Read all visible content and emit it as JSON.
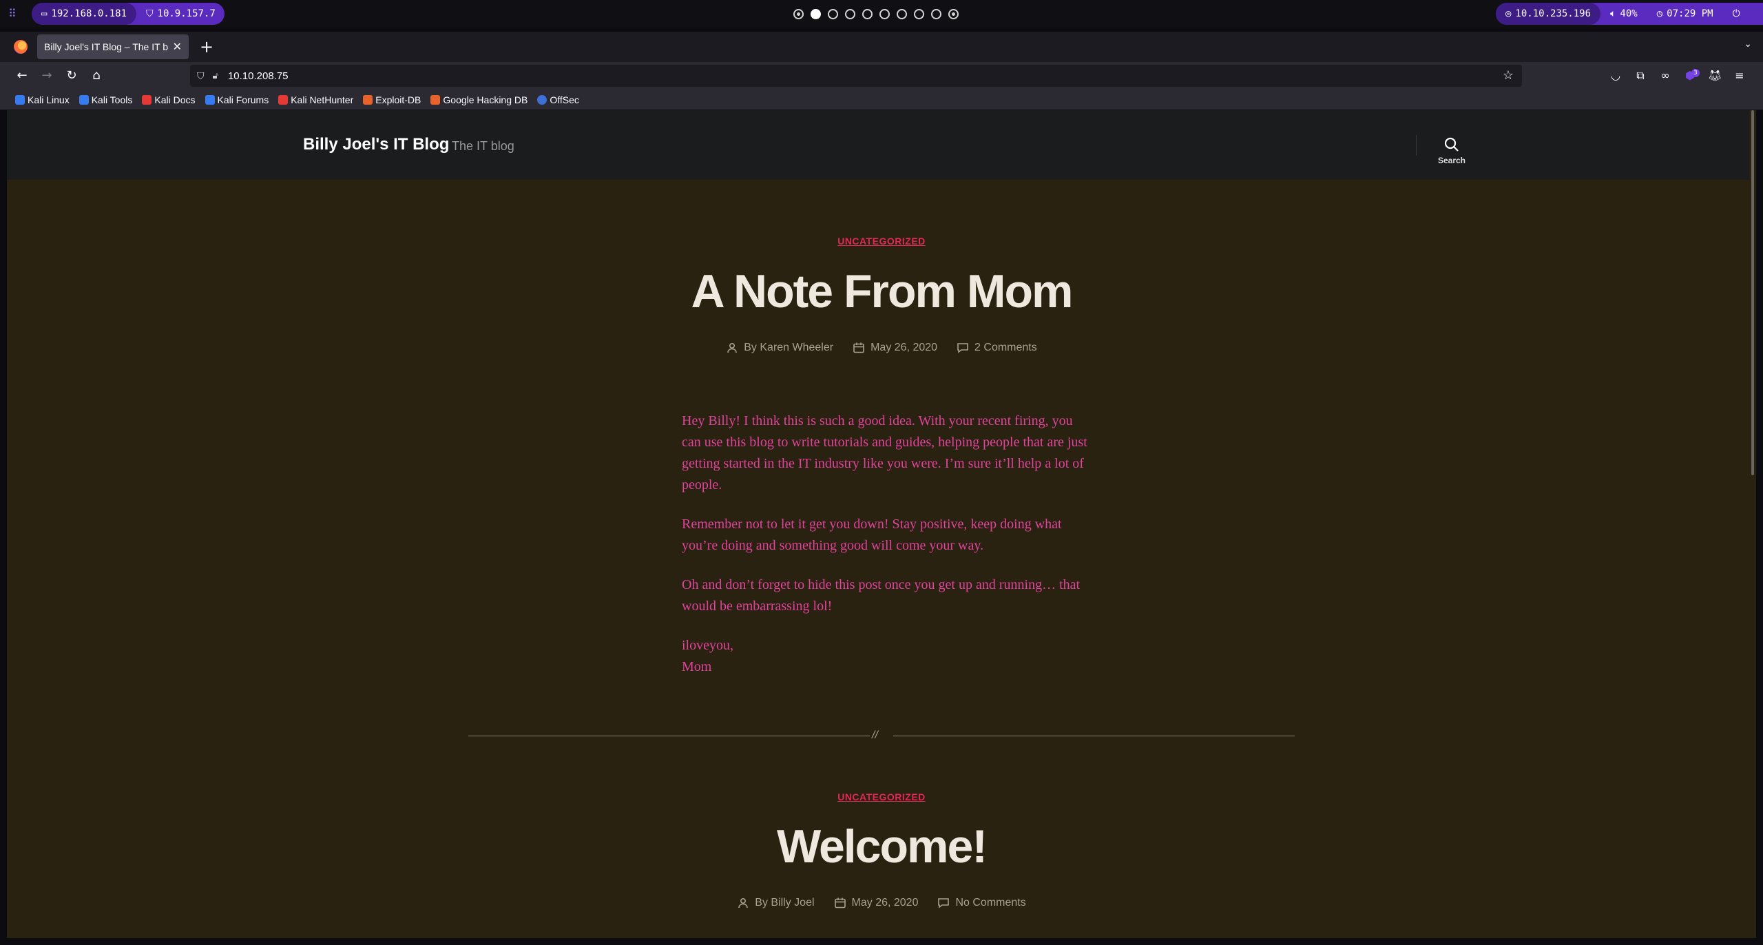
{
  "sysbar": {
    "local_ip": "192.168.0.181",
    "vpn_ip": "10.9.157.7",
    "target_ip": "10.10.235.196",
    "volume": "40%",
    "clock": "07:29 PM",
    "workspaces_count": 10,
    "active_workspace": 1
  },
  "browser": {
    "tab_title": "Billy Joel's IT Blog – The IT blog",
    "url": "10.10.208.75",
    "extension_badge": "3",
    "bookmarks": [
      {
        "label": "Kali Linux",
        "icon": "kali-dragon-icon",
        "color": "#367bf0"
      },
      {
        "label": "Kali Tools",
        "icon": "kali-tools-icon",
        "color": "#367bf0"
      },
      {
        "label": "Kali Docs",
        "icon": "kali-docs-icon",
        "color": "#e53935"
      },
      {
        "label": "Kali Forums",
        "icon": "kali-forums-icon",
        "color": "#367bf0"
      },
      {
        "label": "Kali NetHunter",
        "icon": "kali-nethunter-icon",
        "color": "#e53935"
      },
      {
        "label": "Exploit-DB",
        "icon": "exploit-db-icon",
        "color": "#e8632b"
      },
      {
        "label": "Google Hacking DB",
        "icon": "ghdb-icon",
        "color": "#e8632b"
      },
      {
        "label": "OffSec",
        "icon": "offsec-icon",
        "color": "#3d6fd6"
      }
    ]
  },
  "site": {
    "title": "Billy Joel's IT Blog",
    "description": "The IT blog",
    "search_label": "Search"
  },
  "posts": [
    {
      "category": "UNCATEGORIZED",
      "title": "A Note From Mom",
      "author": "By Karen Wheeler",
      "date": "May 26, 2020",
      "comments": "2 Comments",
      "paragraphs": [
        "Hey Billy!  I think this is such a good idea.  With your recent firing, you can use this blog to write tutorials and guides, helping people that are just getting started in the IT industry like you were.  I’m sure it’ll help a lot of people.",
        "Remember not to let it get you down!  Stay positive, keep doing what you’re doing and something good will come your way.",
        "Oh and don’t forget to hide this post once you get up and running… that would be embarrassing lol!"
      ],
      "signoff_1": "iloveyou,",
      "signoff_2": "Mom"
    },
    {
      "category": "UNCATEGORIZED",
      "title": "Welcome!",
      "author": "By Billy Joel",
      "date": "May 26, 2020",
      "comments": "No Comments"
    }
  ],
  "separator_text": "//",
  "colors": {
    "accent": "#e22658",
    "body_text": "#e0429c",
    "page_bg": "#2a2210",
    "header_bg": "#1b1c1e",
    "title": "#efe8de"
  }
}
